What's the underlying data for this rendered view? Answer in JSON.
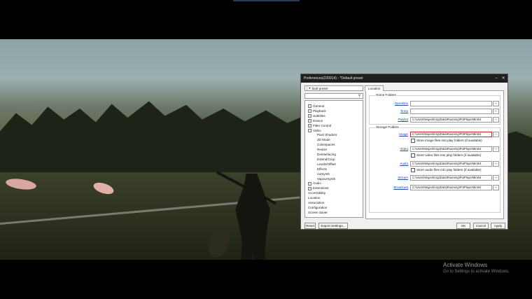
{
  "dialog": {
    "title": "Preferences(220914) - *Default preset",
    "controls": {
      "minimize": "–",
      "close": "✕"
    },
    "preset": "*Default preset",
    "tree": [
      {
        "label": "General",
        "exp": "+",
        "depth": 0
      },
      {
        "label": "Playback",
        "exp": "+",
        "depth": 0
      },
      {
        "label": "Subtitles",
        "exp": "+",
        "depth": 0
      },
      {
        "label": "Device",
        "exp": "+",
        "depth": 0
      },
      {
        "label": "Filter Control",
        "exp": "+",
        "depth": 0
      },
      {
        "label": "Video",
        "exp": "-",
        "depth": 0
      },
      {
        "label": "Pixel Shaders",
        "exp": "",
        "depth": 1
      },
      {
        "label": "3D Mode",
        "exp": "",
        "depth": 1
      },
      {
        "label": "Colorspaces",
        "exp": "",
        "depth": 1
      },
      {
        "label": "Resize",
        "exp": "",
        "depth": 1
      },
      {
        "label": "Deinterlacing",
        "exp": "",
        "depth": 1
      },
      {
        "label": "Extend/Crop",
        "exp": "",
        "depth": 1
      },
      {
        "label": "Levels/Offset",
        "exp": "",
        "depth": 1
      },
      {
        "label": "Effects",
        "exp": "",
        "depth": 1
      },
      {
        "label": "AviSynth",
        "exp": "",
        "depth": 1
      },
      {
        "label": "VapourSynth",
        "exp": "",
        "depth": 1
      },
      {
        "label": "Audio",
        "exp": "+",
        "depth": 0
      },
      {
        "label": "Extensions",
        "exp": "+",
        "depth": 0
      },
      {
        "label": "Accessibility",
        "exp": "",
        "depth": 0
      },
      {
        "label": "Location",
        "exp": "",
        "depth": 0
      },
      {
        "label": "Association",
        "exp": "",
        "depth": 0
      },
      {
        "label": "Configuration",
        "exp": "",
        "depth": 0
      },
      {
        "label": "Screen Saver",
        "exp": "",
        "depth": 0
      }
    ],
    "tab": "Location",
    "home": {
      "heading": "Home Folders",
      "rows": [
        {
          "label": "OpenBox",
          "value": ""
        },
        {
          "label": "Temp",
          "value": ""
        },
        {
          "label": "Playlist",
          "value": "C:\\Users\\Mujeeb\\AppData\\Roaming\\PotPlayerMini64"
        }
      ]
    },
    "storage": {
      "heading": "Storage Folders",
      "rows": [
        {
          "label": "Image",
          "value": "C:\\Users\\Mujeeb\\AppData\\Roaming\\PotPlayerMini64",
          "check": "Store image files into play folders (if available)"
        },
        {
          "label": "Video",
          "value": "C:\\Users\\Mujeeb\\AppData\\Roaming\\PotPlayerMini64",
          "check": "Store video files into play folders (if available)"
        },
        {
          "label": "Audio",
          "value": "C:\\Users\\Mujeeb\\AppData\\Roaming\\PotPlayerMini64",
          "check": "Store audio files into play folders (if available)"
        },
        {
          "label": "Stream",
          "value": "C:\\Users\\Mujeeb\\AppData\\Roaming\\PotPlayerMini64",
          "check": ""
        },
        {
          "label": "Broadcast",
          "value": "C:\\Users\\Mujeeb\\AppData\\Roaming\\PotPlayerMini64",
          "check": ""
        }
      ]
    },
    "browse": "...",
    "buttons": {
      "reset": "Reset",
      "export": "Export Settings...",
      "ok": "OK",
      "cancel": "Cancel",
      "apply": "Apply"
    }
  },
  "watermark": {
    "title": "Activate Windows",
    "sub": "Go to Settings to activate Windows."
  }
}
